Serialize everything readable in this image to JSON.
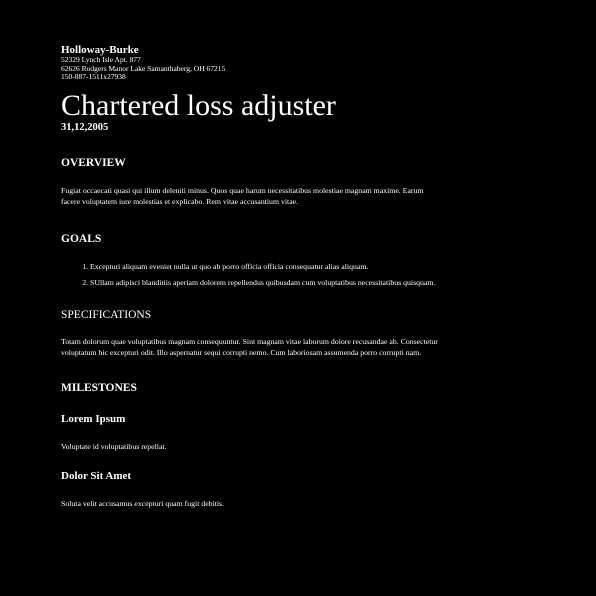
{
  "header": {
    "company": "Holloway-Burke",
    "address_lines": [
      "52329 Lynch Isle Apt. 877",
      "62626 Rodgers Manor Lake Samanthaberg, OH 67215",
      "150-887-1511x27938"
    ]
  },
  "title": "Chartered loss adjuster",
  "date": "31,12,2005",
  "overview": {
    "heading": "OVERVIEW",
    "text": "Fugiat occaecati quasi qui illum deleniti minus. Quos quae harum necessitatibus molestiae magnam maxime. Earum facere voluptatem iure molestias et explicabo. Rem vitae accusantium vitae."
  },
  "goals": {
    "heading": "GOALS",
    "items": [
      "Excepturi aliquam eveniet nulla ut quo ab porro officia officia consequatur alias aliquam.",
      "SUllam adipisci blanditiis aperiam dolorem repellendus quibusdam cum voluptatibus necessitatibus quisquam."
    ]
  },
  "specifications": {
    "heading": "SPECIFICATIONS",
    "text": "Totam dolorum quae voluptatibus magnam consequuntur. Sint magnam vitae laborum dolore recusandae ab. Consectetur voluptatum hic excepturi odit. Illo aspernatur sequi corrupti nemo. Cum laboriosam assumenda porro corrupti nam."
  },
  "milestones": {
    "heading": "MILESTONES",
    "items": [
      {
        "title": "Lorem Ipsum",
        "text": "Voluptate id voluptatibus repellat."
      },
      {
        "title": "Dolor Sit Amet",
        "text": "Soluta velit accusamus excepturi quam fugit debitis."
      }
    ]
  }
}
